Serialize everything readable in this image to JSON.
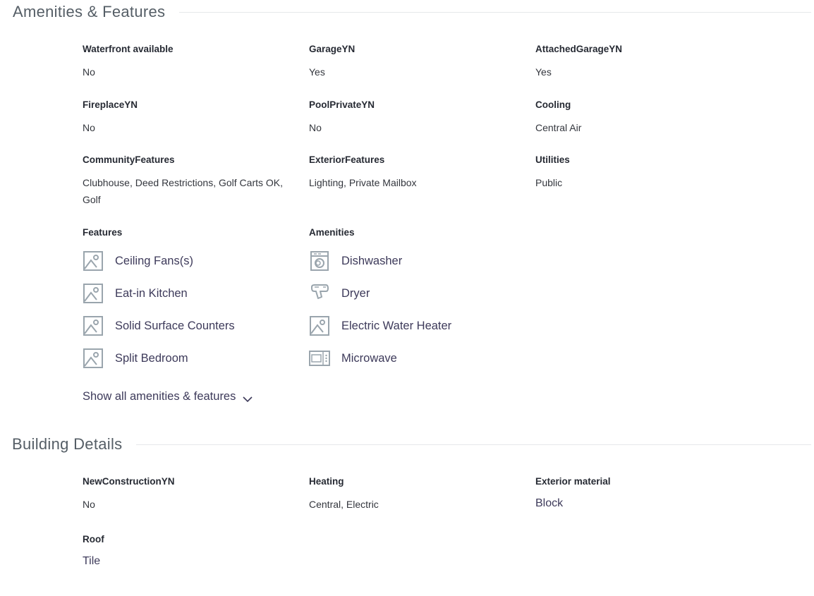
{
  "amenities_section": {
    "title": "Amenities & Features",
    "fields": [
      {
        "label": "Waterfront available",
        "value": "No"
      },
      {
        "label": "GarageYN",
        "value": "Yes"
      },
      {
        "label": "AttachedGarageYN",
        "value": "Yes"
      },
      {
        "label": "FireplaceYN",
        "value": "No"
      },
      {
        "label": "PoolPrivateYN",
        "value": "No"
      },
      {
        "label": "Cooling",
        "value": "Central Air"
      },
      {
        "label": "CommunityFeatures",
        "value": "Clubhouse, Deed Restrictions, Golf Carts OK, Golf"
      },
      {
        "label": "ExteriorFeatures",
        "value": "Lighting, Private Mailbox"
      },
      {
        "label": "Utilities",
        "value": "Public"
      }
    ],
    "features": {
      "label": "Features",
      "items": [
        {
          "text": "Ceiling Fans(s)",
          "icon": "image-placeholder-icon"
        },
        {
          "text": "Eat-in Kitchen",
          "icon": "image-placeholder-icon"
        },
        {
          "text": "Solid Surface Counters",
          "icon": "image-placeholder-icon"
        },
        {
          "text": "Split Bedroom",
          "icon": "image-placeholder-icon"
        }
      ]
    },
    "amenities": {
      "label": "Amenities",
      "items": [
        {
          "text": "Dishwasher",
          "icon": "dishwasher-icon"
        },
        {
          "text": "Dryer",
          "icon": "hair-dryer-icon"
        },
        {
          "text": "Electric Water Heater",
          "icon": "image-placeholder-icon"
        },
        {
          "text": "Microwave",
          "icon": "microwave-icon"
        }
      ]
    },
    "show_all_label": "Show all amenities & features"
  },
  "building_section": {
    "title": "Building Details",
    "fields": [
      {
        "label": "NewConstructionYN",
        "value": "No"
      },
      {
        "label": "Heating",
        "value": "Central, Electric"
      },
      {
        "label": "Exterior material",
        "value": "Block"
      },
      {
        "label": "Roof",
        "value": "Tile"
      }
    ]
  },
  "colors": {
    "icon_stroke": "#9aa5ad",
    "link_text": "#3d3a5a",
    "divider": "#e6e8ea"
  }
}
